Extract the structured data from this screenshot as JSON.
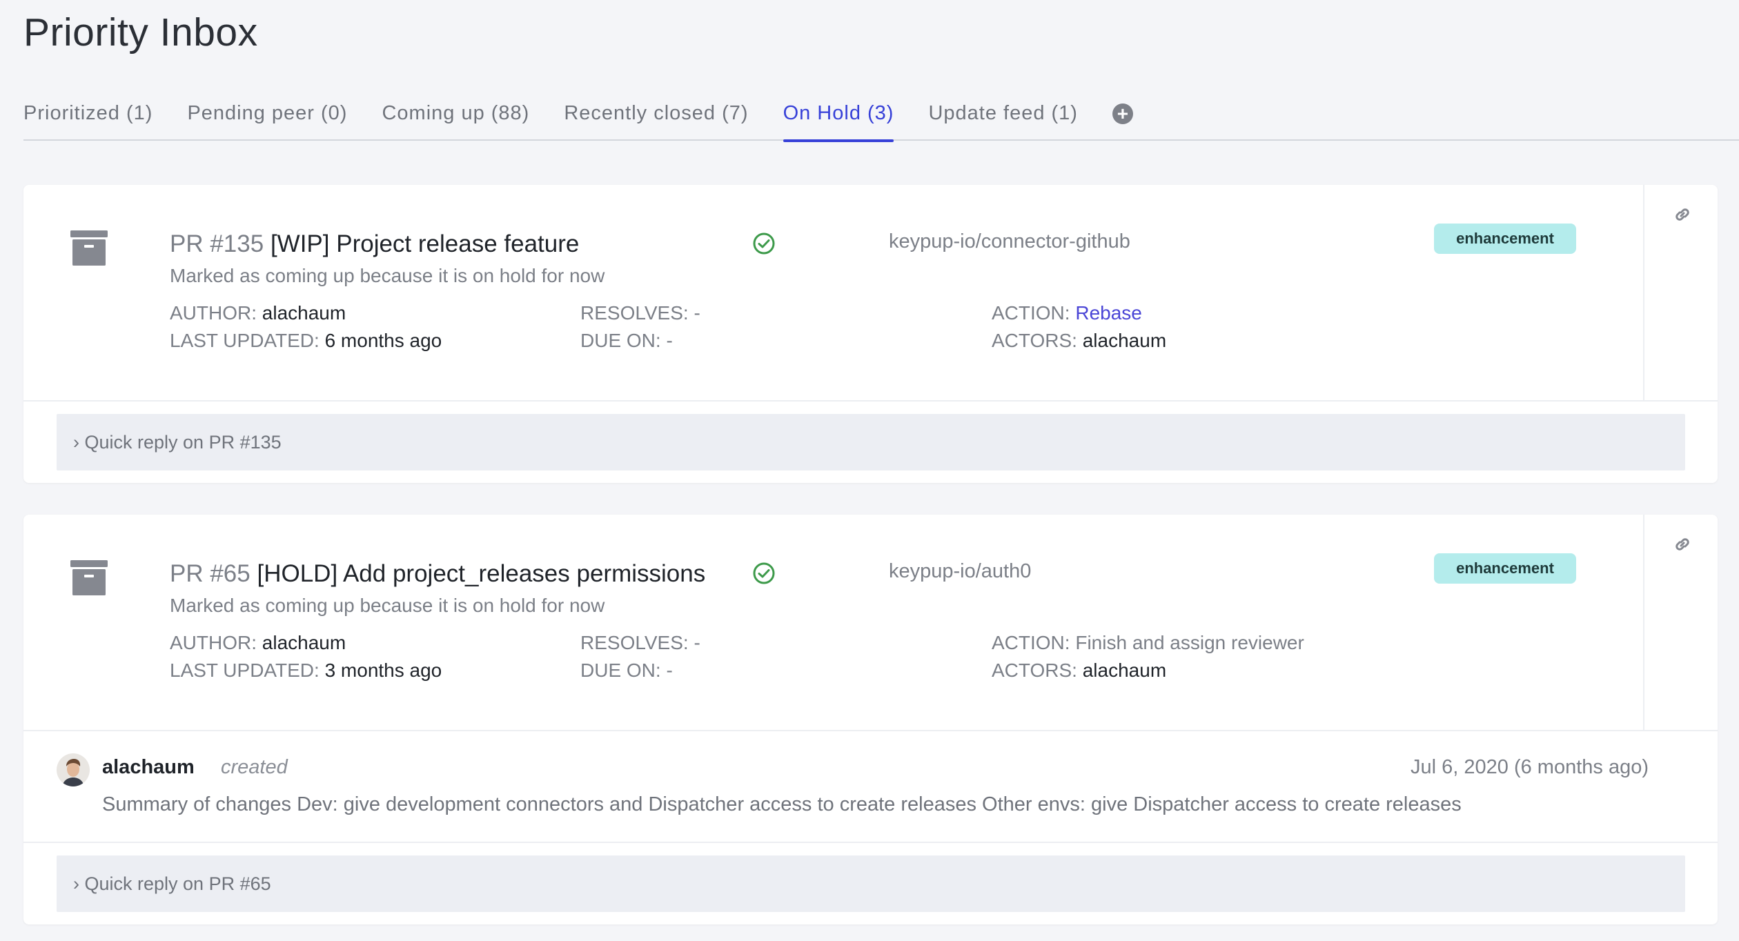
{
  "page": {
    "title": "Priority Inbox"
  },
  "tabs": [
    {
      "label": "Prioritized (1)"
    },
    {
      "label": "Pending peer (0)"
    },
    {
      "label": "Coming up (88)"
    },
    {
      "label": "Recently closed (7)"
    },
    {
      "label": "On Hold (3)",
      "active": true
    },
    {
      "label": "Update feed (1)"
    }
  ],
  "tab_add_icon": "plus-circle-icon",
  "colors": {
    "accent": "#3640d8",
    "badge": "#b4ecec",
    "check": "#3d9a4a",
    "link": "#4b46d6"
  },
  "items": [
    {
      "number": "PR #135",
      "title": "[WIP] Project release feature",
      "subtitle": "Marked as coming up because it is on hold for now",
      "repo": "keypup-io/connector-github",
      "label": "enhancement",
      "author_key": "AUTHOR",
      "author": "alachaum",
      "updated_key": "LAST UPDATED",
      "updated": "6 months ago",
      "resolves_key": "RESOLVES",
      "resolves": "-",
      "due_key": "DUE ON",
      "due": "-",
      "action_key": "ACTION",
      "action": "Rebase",
      "actors_key": "ACTORS",
      "actors": "alachaum",
      "quick_reply": "› Quick reply on PR #135"
    },
    {
      "number": "PR #65",
      "title": "[HOLD] Add project_releases permissions",
      "subtitle": "Marked as coming up because it is on hold for now",
      "repo": "keypup-io/auth0",
      "label": "enhancement",
      "author_key": "AUTHOR",
      "author": "alachaum",
      "updated_key": "LAST UPDATED",
      "updated": "3 months ago",
      "resolves_key": "RESOLVES",
      "resolves": "-",
      "due_key": "DUE ON",
      "due": "-",
      "action_key": "ACTION",
      "action": "Finish and assign reviewer",
      "actors_key": "ACTORS",
      "actors": "alachaum",
      "comment": {
        "author": "alachaum",
        "verb": "created",
        "date": "Jul 6, 2020 (6 months ago)",
        "body": "Summary of changes Dev: give development connectors and Dispatcher access to create releases Other envs: give Dispatcher access to create releases"
      },
      "quick_reply": "› Quick reply on PR #65"
    }
  ]
}
